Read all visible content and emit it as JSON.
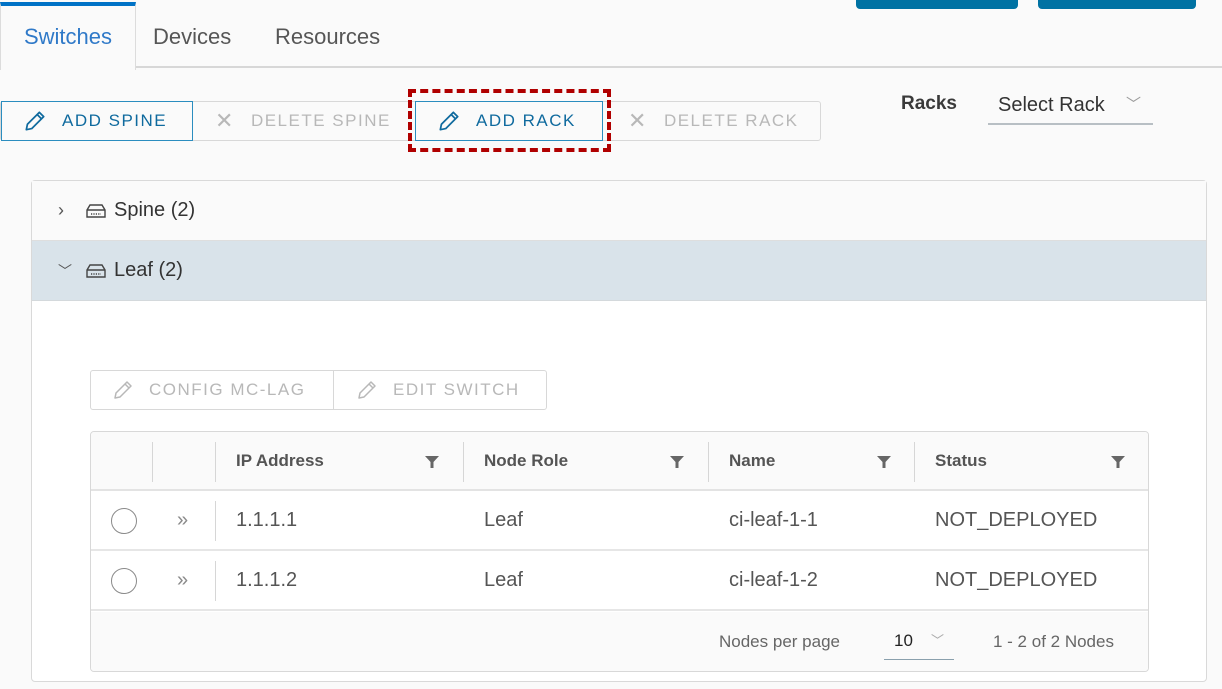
{
  "tabs": [
    {
      "label": "Switches",
      "active": true
    },
    {
      "label": "Devices",
      "active": false
    },
    {
      "label": "Resources",
      "active": false
    }
  ],
  "toolbar": {
    "add_spine": "ADD SPINE",
    "delete_spine": "DELETE SPINE",
    "add_rack": "ADD RACK",
    "delete_rack": "DELETE RACK"
  },
  "racks": {
    "label": "Racks",
    "select_value": "Select Rack"
  },
  "accordion": {
    "spine": {
      "label": "Spine (2)",
      "expanded": false
    },
    "leaf": {
      "label": "Leaf (2)",
      "expanded": true
    }
  },
  "leaf_actions": {
    "config_mc_lag": "CONFIG MC-LAG",
    "edit_switch": "EDIT SWITCH"
  },
  "grid": {
    "columns": [
      "IP Address",
      "Node Role",
      "Name",
      "Status"
    ],
    "rows": [
      {
        "ip": "1.1.1.1",
        "role": "Leaf",
        "name": "ci-leaf-1-1",
        "status": "NOT_DEPLOYED"
      },
      {
        "ip": "1.1.1.2",
        "role": "Leaf",
        "name": "ci-leaf-1-2",
        "status": "NOT_DEPLOYED"
      }
    ],
    "footer": {
      "per_page_label": "Nodes per page",
      "per_page_value": "10",
      "count_text": "1 - 2 of 2 Nodes"
    }
  },
  "colors": {
    "accent": "#0072a3",
    "active_tab": "#2f79c8",
    "highlight": "#b00000",
    "leaf_row_bg": "#d9e3ea"
  }
}
